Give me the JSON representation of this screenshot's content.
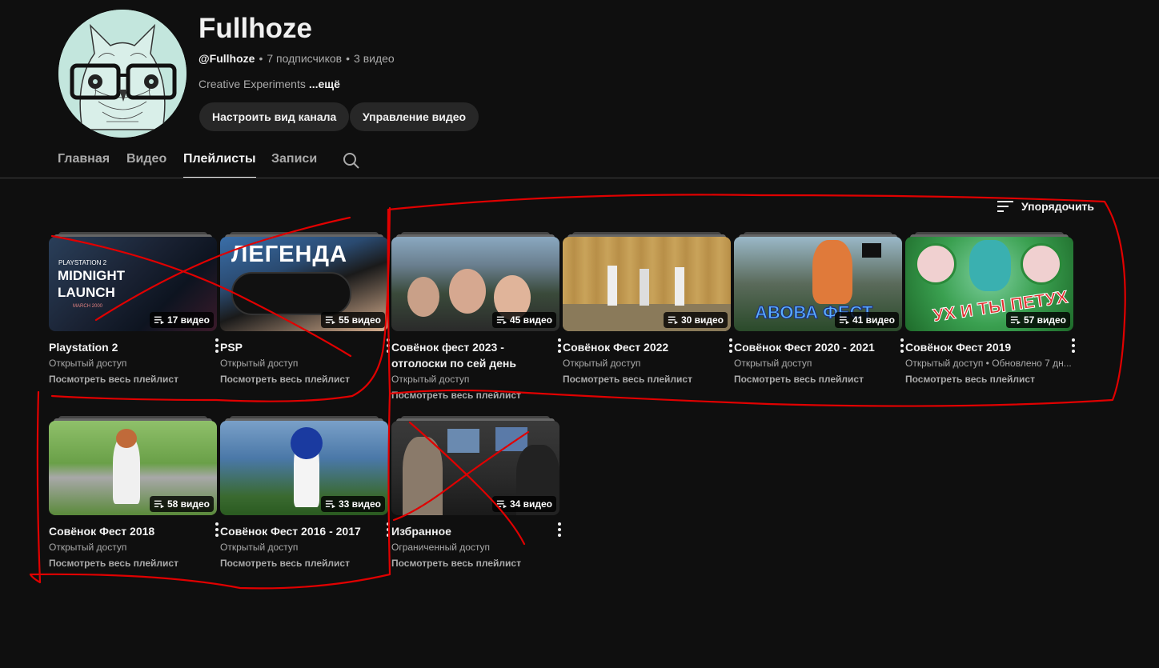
{
  "channel": {
    "title": "Fullhoze",
    "handle": "@Fullhoze",
    "subscribers": "7 подписчиков",
    "videos": "3 видео",
    "description": "Creative Experiments",
    "more": "...ещё",
    "customize_label": "Настроить вид канала",
    "manage_label": "Управление видео"
  },
  "tabs": [
    {
      "label": "Главная",
      "active": false
    },
    {
      "label": "Видео",
      "active": false
    },
    {
      "label": "Плейлисты",
      "active": true
    },
    {
      "label": "Записи",
      "active": false
    }
  ],
  "sort": {
    "label": "Упорядочить"
  },
  "playlists": [
    {
      "title": "Playstation 2",
      "count": "17 видео",
      "access": "Открытый доступ",
      "link": "Посмотреть весь плейлист",
      "thumb_text_small": "PLAYSTATION 2",
      "thumb_text_big": "MIDNIGHT LAUNCH",
      "thumb_text_date": "MARCH 2000"
    },
    {
      "title": "PSP",
      "count": "55 видео",
      "access": "Открытый доступ",
      "link": "Посмотреть весь плейлист",
      "thumb_text_big": "ЛЕГЕНДА"
    },
    {
      "title": "Совёнок фест 2023 - отголоски по сей день",
      "count": "45 видео",
      "access": "Открытый доступ",
      "link": "Посмотреть весь плейлист"
    },
    {
      "title": "Совёнок Фест 2022",
      "count": "30 видео",
      "access": "Открытый доступ",
      "link": "Посмотреть весь плейлист"
    },
    {
      "title": "Совёнок Фест 2020 - 2021",
      "count": "41 видео",
      "access": "Открытый доступ",
      "link": "Посмотреть весь плейлист",
      "thumb_text_big": "АВОВА ФЕСТ"
    },
    {
      "title": "Совёнок Фест 2019",
      "count": "57 видео",
      "access": "Открытый доступ • Обновлено 7 дн...",
      "link": "Посмотреть весь плейлист",
      "thumb_text_big": "УХ И ТЫ ПЕТУХ"
    },
    {
      "title": "Совёнок Фест 2018",
      "count": "58 видео",
      "access": "Открытый доступ",
      "link": "Посмотреть весь плейлист"
    },
    {
      "title": "Совёнок Фест 2016 - 2017",
      "count": "33 видео",
      "access": "Открытый доступ",
      "link": "Посмотреть весь плейлист"
    },
    {
      "title": "Избранное",
      "count": "34 видео",
      "access": "Ограниченный доступ",
      "link": "Посмотреть весь плейлист"
    }
  ],
  "colors": {
    "background": "#0f0f0f",
    "text_primary": "#f1f1f1",
    "text_secondary": "#aaaaaa",
    "button_bg": "#272727",
    "annotation_red": "#e00000"
  }
}
